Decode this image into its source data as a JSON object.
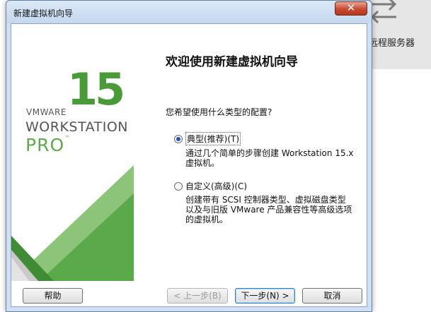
{
  "background": {
    "remote_label": "远程服务器",
    "icons": [
      "plus-circle-icon",
      "edit-icon",
      "transfer-arrows-icon"
    ]
  },
  "dialog": {
    "title": "新建虚拟机向导",
    "close_label": "✕",
    "banner": {
      "big_number": "15",
      "brand": "VMWARE",
      "product": "WORKSTATION",
      "edition": "PRO",
      "trademark": "™"
    },
    "heading": "欢迎使用新建虚拟机向导",
    "question": "您希望使用什么类型的配置?",
    "options": [
      {
        "label": "典型(推荐)(T)",
        "checked": true,
        "desc_lines": [
          "通过几个简单的步骤创建 Workstation 15.x",
          "虚拟机。"
        ]
      },
      {
        "label": "自定义(高级)(C)",
        "checked": false,
        "desc_lines": [
          "创建带有 SCSI 控制器类型、虚拟磁盘类型",
          "以及与旧版 VMware 产品兼容性等高级选项",
          "的虚拟机。"
        ]
      }
    ],
    "buttons": {
      "help": "帮助",
      "back": "< 上一步(B)",
      "next": "下一步(N) >",
      "cancel": "取消"
    }
  },
  "colors": {
    "brand_green": "#4b9a3a",
    "triangle_light": "#8cc47a",
    "triangle_dark": "#3f8c35"
  }
}
